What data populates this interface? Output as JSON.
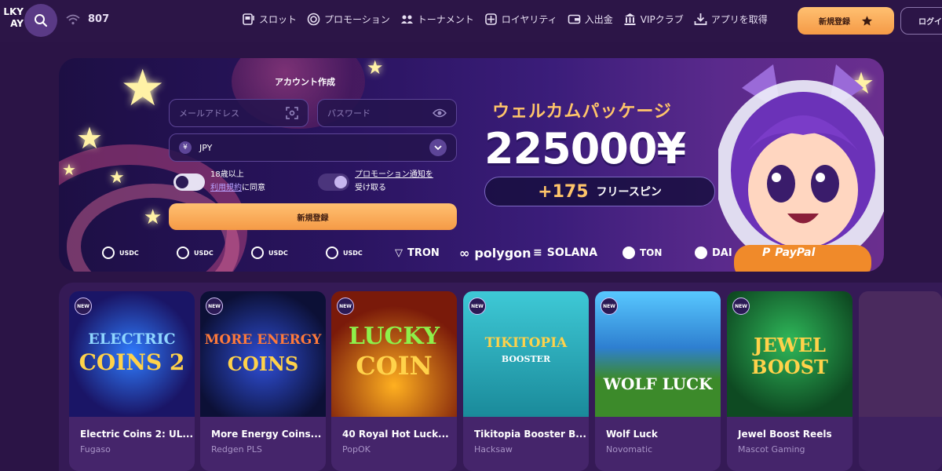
{
  "header": {
    "logo_text": "LKY\nAY",
    "online_count": "807",
    "nav": [
      {
        "label": "スロット",
        "icon": "slot-icon"
      },
      {
        "label": "プロモーション",
        "icon": "promotion-icon"
      },
      {
        "label": "トーナメント",
        "icon": "tournament-icon"
      },
      {
        "label": "ロイヤリティ",
        "icon": "loyalty-icon"
      },
      {
        "label": "入出金",
        "icon": "wallet-icon"
      },
      {
        "label": "VIPクラブ",
        "icon": "vip-icon"
      },
      {
        "label": "アプリを取得",
        "icon": "download-icon"
      }
    ],
    "register_label": "新規登録",
    "login_label": "ログイ"
  },
  "signup": {
    "title": "アカウント作成",
    "email_placeholder": "メールアドレス",
    "password_placeholder": "パスワード",
    "currency": "JPY",
    "age_label": "18歳以上",
    "terms_link": "利用規約",
    "terms_suffix": "に同意",
    "promo_label_1": "プロモーション通知を",
    "promo_label_2": "受け取る",
    "submit_label": "新規登録"
  },
  "welcome": {
    "title": "ウェルカムパッケージ",
    "amount": "225000¥",
    "spins_count": "+175",
    "spins_label": "フリースピン"
  },
  "payments": [
    "USDC",
    "USDC",
    "USDC",
    "USDC",
    "TRON",
    "polygon",
    "SOLANA",
    "TON",
    "DAI",
    "PayPal"
  ],
  "games": [
    {
      "name": "Electric Coins 2: UL...",
      "provider": "Fugaso",
      "art_line1": "ELECTRIC",
      "art_line2": "COINS 2"
    },
    {
      "name": "More Energy Coins...",
      "provider": "Redgen PLS",
      "art_line1": "MORE ENERGY",
      "art_line2": "COINS"
    },
    {
      "name": "40 Royal Hot Luck...",
      "provider": "PopOK",
      "art_line1": "LUCKY",
      "art_line2": "COIN"
    },
    {
      "name": "Tikitopia Booster B...",
      "provider": "Hacksaw",
      "art_line1": "TIKITOPIA",
      "art_line2": "BOOSTER"
    },
    {
      "name": "Wolf Luck",
      "provider": "Novomatic",
      "art_line1": "WOLF LUCK",
      "art_line2": ""
    },
    {
      "name": "Jewel Boost Reels",
      "provider": "Mascot Gaming",
      "art_line1": "JEWEL",
      "art_line2": "BOOST"
    }
  ],
  "badges": {
    "new": "NEW"
  }
}
